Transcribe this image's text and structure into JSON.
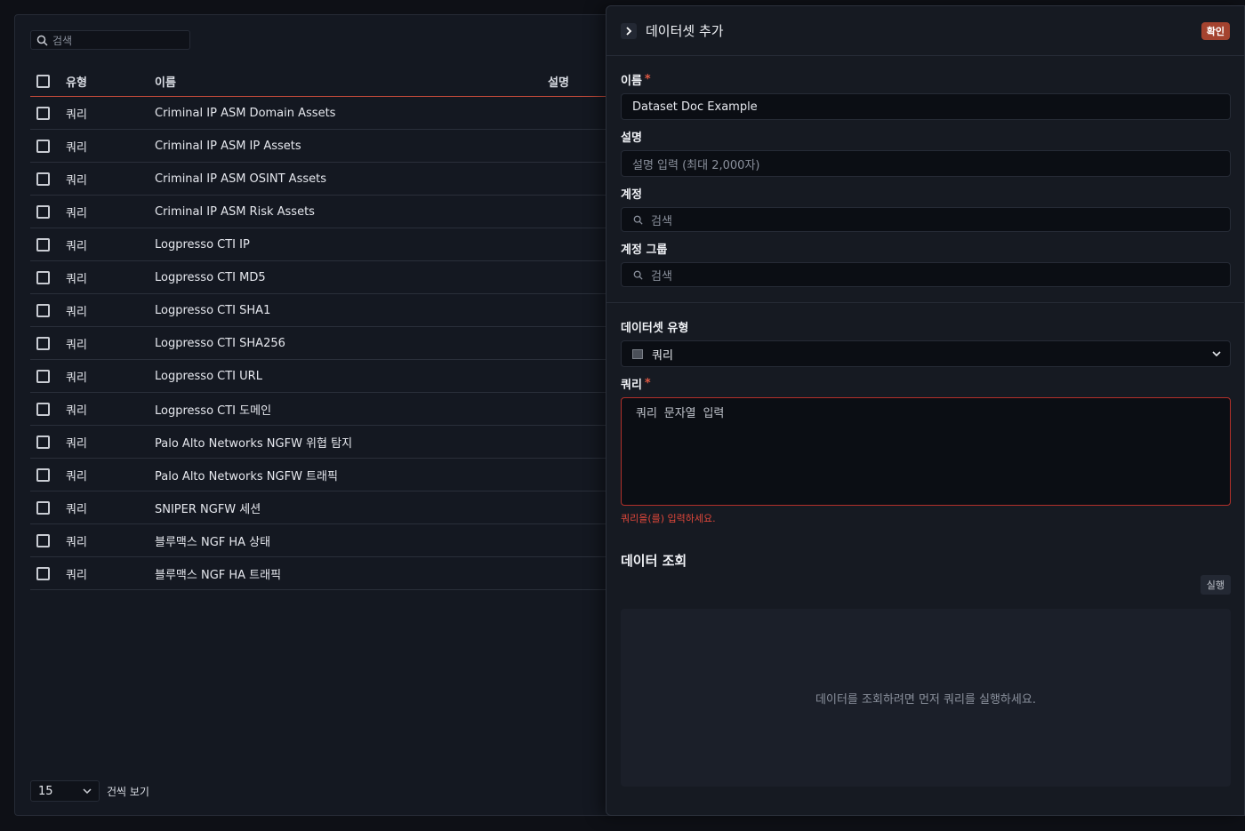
{
  "list": {
    "search_placeholder": "검색",
    "columns": {
      "type": "유형",
      "name": "이름",
      "description": "설명"
    },
    "rows": [
      {
        "type": "쿼리",
        "name": "Criminal IP ASM Domain Assets"
      },
      {
        "type": "쿼리",
        "name": "Criminal IP ASM IP Assets"
      },
      {
        "type": "쿼리",
        "name": "Criminal IP ASM OSINT Assets"
      },
      {
        "type": "쿼리",
        "name": "Criminal IP ASM Risk Assets"
      },
      {
        "type": "쿼리",
        "name": "Logpresso CTI IP"
      },
      {
        "type": "쿼리",
        "name": "Logpresso CTI MD5"
      },
      {
        "type": "쿼리",
        "name": "Logpresso CTI SHA1"
      },
      {
        "type": "쿼리",
        "name": "Logpresso CTI SHA256"
      },
      {
        "type": "쿼리",
        "name": "Logpresso CTI URL"
      },
      {
        "type": "쿼리",
        "name": "Logpresso CTI 도메인"
      },
      {
        "type": "쿼리",
        "name": "Palo Alto Networks NGFW 위협 탐지"
      },
      {
        "type": "쿼리",
        "name": "Palo Alto Networks NGFW 트래픽"
      },
      {
        "type": "쿼리",
        "name": "SNIPER NGFW 세션"
      },
      {
        "type": "쿼리",
        "name": "블루맥스 NGF HA 상태"
      },
      {
        "type": "쿼리",
        "name": "블루맥스 NGF HA 트래픽"
      }
    ],
    "page_size": "15",
    "page_size_label": "건씩 보기"
  },
  "drawer": {
    "title": "데이터셋 추가",
    "confirm_label": "확인",
    "name_label": "이름",
    "name_value": "Dataset Doc Example",
    "desc_label": "설명",
    "desc_placeholder": "설명 입력 (최대 2,000자)",
    "account_label": "계정",
    "account_placeholder": "검색",
    "account_group_label": "계정 그룹",
    "account_group_placeholder": "검색",
    "dataset_type_label": "데이터셋 유형",
    "dataset_type_value": "쿼리",
    "query_label": "쿼리",
    "query_placeholder": "쿼리 문자열 입력",
    "query_error": "쿼리을(를) 입력하세요.",
    "data_view_title": "데이터 조회",
    "run_label": "실행",
    "empty_message": "데이터를 조회하려면 먼저 쿼리를 실행하세요."
  },
  "colors": {
    "accent": "#a4432f",
    "error": "#e0473a",
    "background": "#0e1016"
  }
}
